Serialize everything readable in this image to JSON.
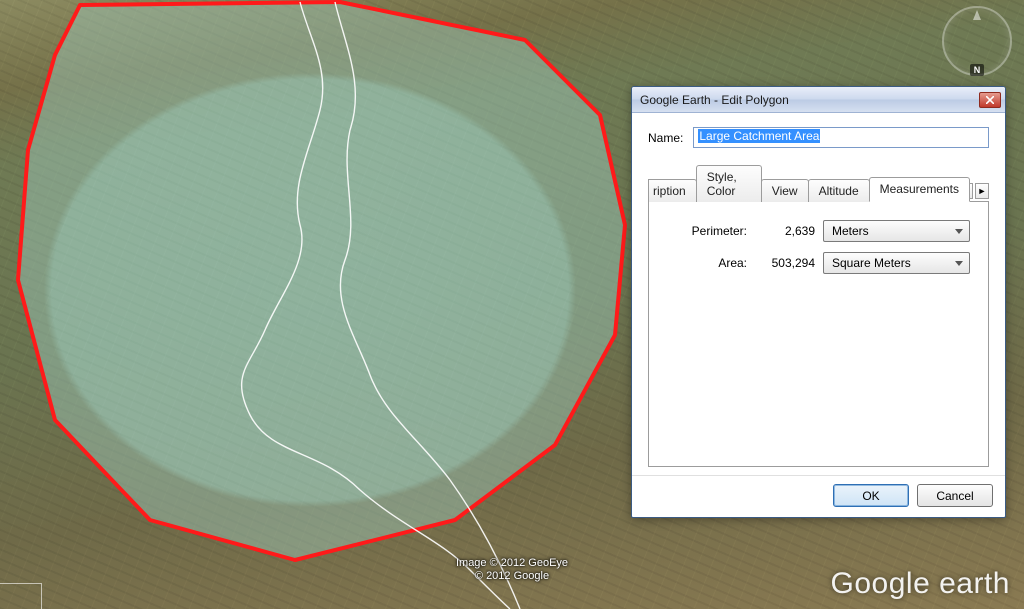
{
  "compass": {
    "north_label": "N"
  },
  "attribution": {
    "line1": "Image © 2012 GeoEye",
    "line2": "© 2012 Google"
  },
  "watermark": {
    "brand_a": "Google",
    "brand_b": " earth"
  },
  "dialog": {
    "title": "Google Earth - Edit Polygon",
    "name_label": "Name:",
    "name_value": "Large Catchment Area",
    "tabs": {
      "partial": "ription",
      "style": "Style, Color",
      "view": "View",
      "altitude": "Altitude",
      "measurements": "Measurements"
    },
    "measurements": {
      "perimeter_label": "Perimeter:",
      "perimeter_value": "2,639",
      "perimeter_unit": "Meters",
      "area_label": "Area:",
      "area_value": "503,294",
      "area_unit": "Square Meters"
    },
    "buttons": {
      "ok": "OK",
      "cancel": "Cancel"
    }
  }
}
